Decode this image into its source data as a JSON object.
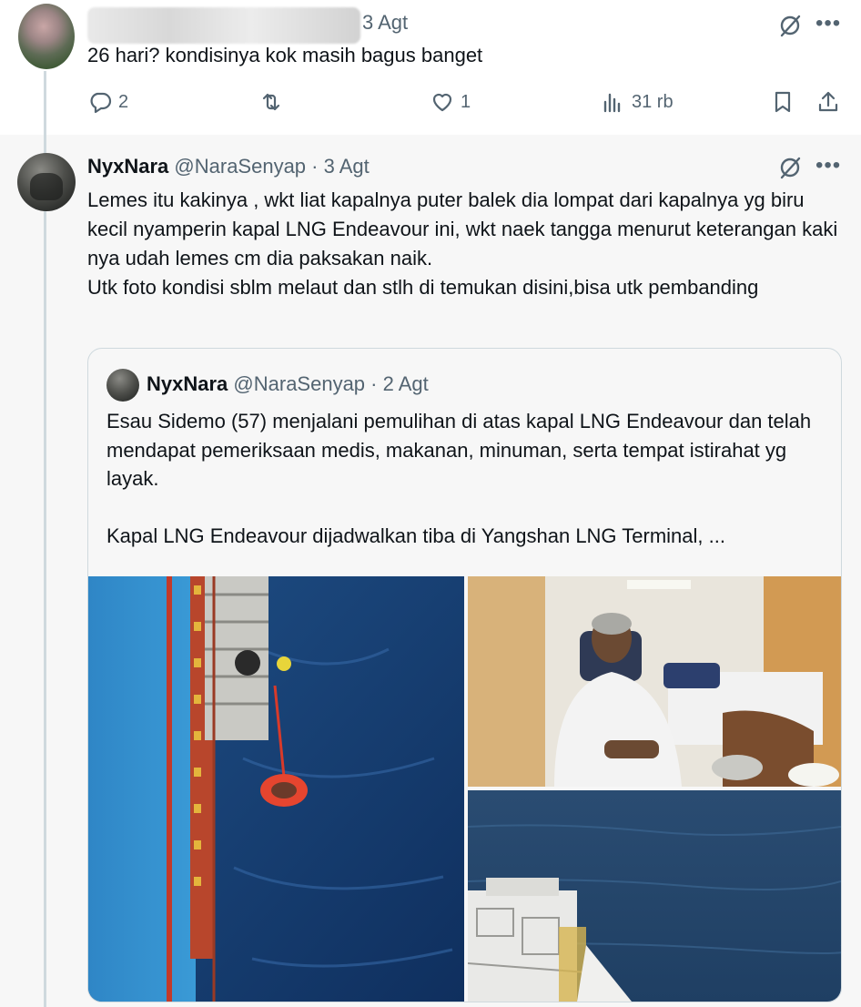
{
  "top_post": {
    "date": "3 Agt",
    "text": "26 hari? kondisinya kok masih bagus banget",
    "actions": {
      "replies": "2",
      "likes": "1",
      "views": "31 rb"
    },
    "icons": [
      "grok-icon",
      "more-icon",
      "reply-icon",
      "retweet-icon",
      "like-icon",
      "views-icon",
      "bookmark-icon",
      "share-icon"
    ]
  },
  "reply": {
    "name": "NyxNara",
    "handle": "@NaraSenyap",
    "date": "3 Agt",
    "separator": " · ",
    "lines": [
      "Lemes itu kakinya , wkt liat kapalnya puter balek dia lompat dari kapalnya yg biru kecil nyamperin kapal LNG Endeavour ini, wkt naek tangga menurut keterangan kaki nya udah lemes cm dia paksakan naik.",
      "Utk foto kondisi sblm melaut dan stlh di temukan disini,bisa utk pembanding"
    ]
  },
  "quote": {
    "name": "NyxNara",
    "handle": "@NaraSenyap",
    "date": "2 Agt",
    "separator": " · ",
    "para1": "Esau Sidemo (57) menjalani pemulihan di atas kapal LNG Endeavour dan telah mendapat pemeriksaan medis, makanan, minuman, serta tempat istirahat yg layak.",
    "para2": "Kapal LNG Endeavour dijadwalkan tiba di Yangshan LNG Terminal, ..."
  },
  "colors": {
    "text": "#0f1419",
    "muted": "#536471",
    "border": "#cfd9de",
    "reply_bg": "#f7f7f7"
  }
}
